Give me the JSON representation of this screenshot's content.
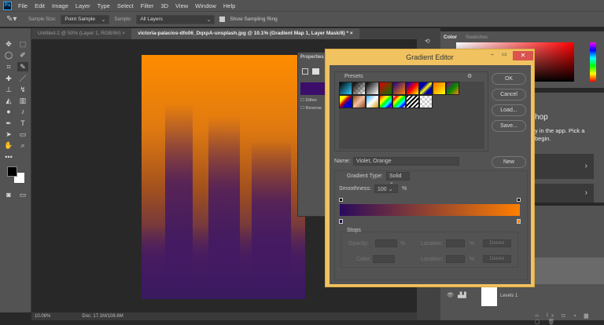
{
  "menubar": {
    "logo": "Ps",
    "items": [
      "File",
      "Edit",
      "Image",
      "Layer",
      "Type",
      "Select",
      "Filter",
      "3D",
      "View",
      "Window",
      "Help"
    ]
  },
  "options": {
    "sample_size_label": "Sample Size:",
    "sample_size_value": "Point Sample",
    "sample_label": "Sample:",
    "sample_value": "All Layers",
    "show_ring_label": "Show Sampling Ring",
    "show_ring_checked": true
  },
  "tabs": [
    {
      "label": "Untitled-2 @ 50% (Layer 1, RGB/8#)",
      "active": false
    },
    {
      "label": "victoria-palacios-dfo06_DqxpA-unsplash.jpg @ 10.1% (Gradient Map 1, Layer Mask/8) *",
      "active": true
    }
  ],
  "status": {
    "zoom": "10.08%",
    "doc": "Doc: 17.1M/108.6M"
  },
  "properties": {
    "title": "Properties",
    "dither": "Dither",
    "reverse": "Reverse"
  },
  "right": {
    "color_tab": "Color",
    "swatches_tab": "Swatches",
    "learn_title": "hop",
    "learn_text1": "y in the app. Pick a",
    "learn_text2": "begin.",
    "layer_name": "Levels 1"
  },
  "gradient_editor": {
    "title": "Gradient Editor",
    "presets_label": "Presets",
    "buttons": {
      "ok": "OK",
      "cancel": "Cancel",
      "load": "Load...",
      "save": "Save...",
      "new": "New"
    },
    "name_label": "Name:",
    "name_value": "Violet, Orange",
    "type_label": "Gradient Type:",
    "type_value": "Solid",
    "smooth_label": "Smoothness:",
    "smooth_value": "100",
    "smooth_unit": "%",
    "stops_label": "Stops",
    "opacity_label": "Opacity:",
    "color_label": "Color:",
    "location_label": "Location:",
    "pct": "%",
    "delete": "Delete",
    "gradient_start": "#2a0a5e",
    "gradient_end": "#ff7f00"
  }
}
